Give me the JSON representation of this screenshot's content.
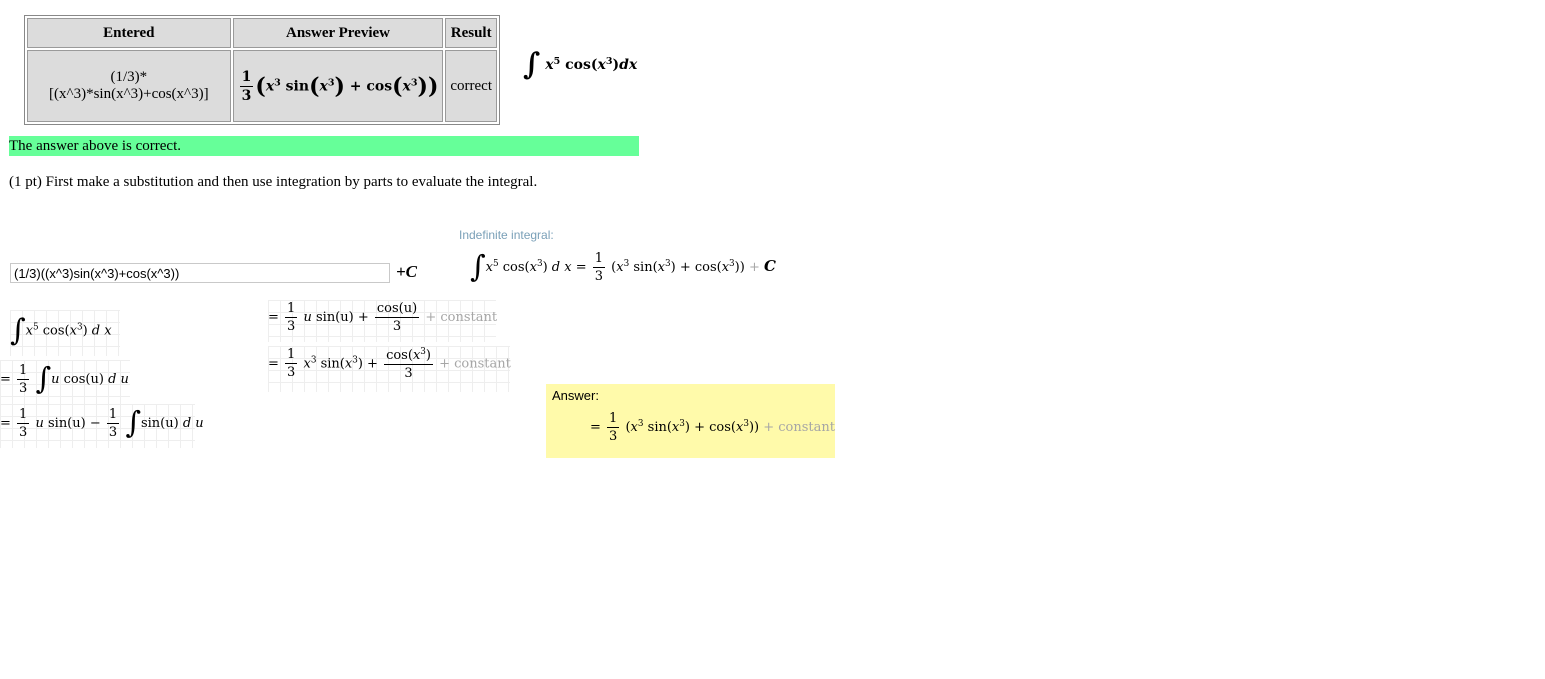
{
  "results_table": {
    "headers": [
      "Entered",
      "Answer Preview",
      "Result"
    ],
    "entered": "(1/3)*[(x^3)*sin(x^3)+cos(x^3)]",
    "preview": {
      "frac_num": "1",
      "frac_den": "3",
      "x": "x",
      "exp": "3",
      "sin": "sin",
      "cos": "cos",
      "plus": "+"
    },
    "result": "correct"
  },
  "integral_display": {
    "integral": "∫",
    "x": "x",
    "exp5": "5",
    "cos": "cos",
    "exp3": "3",
    "dx": "dx"
  },
  "status_message": "The answer above is correct.",
  "problem_text": "(1 pt) First make a substitution and then use integration by parts to evaluate the integral.",
  "answer_input": {
    "value": "(1/3)((x^3)sin(x^3)+cos(x^3))",
    "suffix": "+C"
  },
  "wolfram": {
    "label": "Indefinite integral:",
    "equals": "=",
    "one": "1",
    "three": "3",
    "plus_c": "+ C",
    "constant": "+ constant",
    "answer_label": "Answer:",
    "steps_left": [
      "∫ x5 cos(x3) d x",
      "= 1/3 ∫ u cos(u) d u",
      "= 1/3 u sin(u) − 1/3 ∫ sin(u) d u"
    ],
    "steps_right": [
      "= 1/3 u sin(u) + cos(u)/3 + constant",
      "= 1/3 x3 sin(x3) + cos(x3)/3 + constant"
    ],
    "tokens": {
      "u": "u",
      "du": "d u",
      "dx": "d x",
      "cos_u": "cos(u)",
      "sin_u": "sin(u)",
      "minus": "−",
      "plus": "+",
      "cos_x3": "cos(x",
      "sin_x3": "sin(x"
    }
  }
}
